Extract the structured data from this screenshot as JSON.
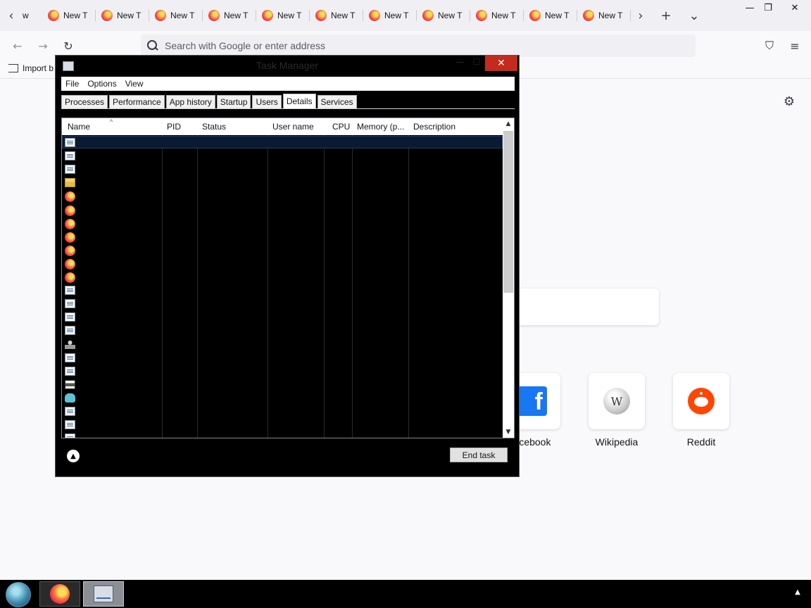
{
  "browser": {
    "tabs": [
      {
        "label": "New T"
      },
      {
        "label": "New T"
      },
      {
        "label": "New T"
      },
      {
        "label": "New T"
      },
      {
        "label": "New T"
      },
      {
        "label": "New T"
      },
      {
        "label": "New T"
      },
      {
        "label": "New T"
      },
      {
        "label": "New T"
      },
      {
        "label": "New T"
      },
      {
        "label": "New T"
      }
    ],
    "first_tab_partial": "w",
    "address_placeholder": "Search with Google or enter address",
    "import_bookmarks_label": "Import b",
    "shortcuts": [
      {
        "label": "acebook",
        "icon": "facebook-icon"
      },
      {
        "label": "Wikipedia",
        "icon": "wikipedia-icon"
      },
      {
        "label": "Reddit",
        "icon": "reddit-icon"
      }
    ]
  },
  "task_manager": {
    "title": "Task Manager",
    "menu": [
      "File",
      "Options",
      "View"
    ],
    "tabs": [
      "Processes",
      "Performance",
      "App history",
      "Startup",
      "Users",
      "Details",
      "Services"
    ],
    "active_tab": "Details",
    "columns": [
      "Name",
      "PID",
      "Status",
      "User name",
      "CPU",
      "Memory (p...",
      "Description"
    ],
    "row_icons": [
      "generic",
      "generic",
      "generic",
      "folder",
      "firefox",
      "firefox",
      "firefox",
      "firefox",
      "firefox",
      "firefox",
      "firefox",
      "generic",
      "generic",
      "generic",
      "generic",
      "user",
      "generic",
      "generic",
      "printer",
      "cloud",
      "generic",
      "generic",
      "generic"
    ],
    "end_task_label": "End task"
  },
  "colors": {
    "accent_close": "#c42b1c",
    "firefox_orange": "#ff7139",
    "facebook_blue": "#1877f2",
    "reddit_orange": "#ff4500"
  }
}
